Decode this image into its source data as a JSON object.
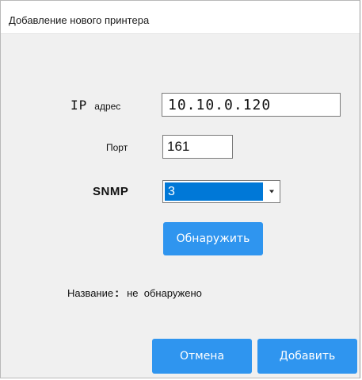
{
  "window": {
    "title": "Добавление нового принтера"
  },
  "form": {
    "ip": {
      "label_main": "IP",
      "label_suffix": "адрес",
      "value": "10.10.0.120"
    },
    "port": {
      "label": "Порт",
      "value": "161"
    },
    "snmp": {
      "label": "SNMP",
      "selected": "3"
    },
    "detect_label": "Обнаружить",
    "name": {
      "label": "Название",
      "colon": ":",
      "value": "не  обнаружено"
    }
  },
  "buttons": {
    "cancel_label": "Отмена",
    "add_label": "Добавить"
  },
  "colors": {
    "accent": "#2f95ef",
    "selection": "#0078d7",
    "window_bg": "#f0f0f0"
  },
  "icons": {
    "dropdown": "caret-down-icon"
  }
}
